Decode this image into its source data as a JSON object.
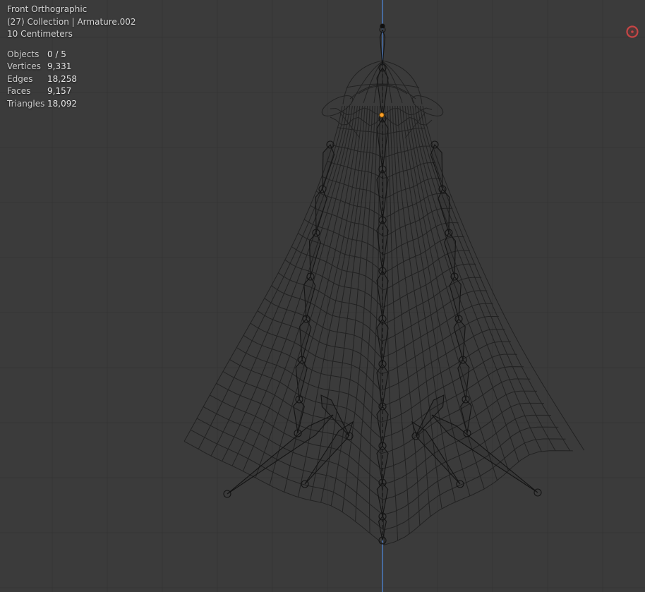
{
  "overlay": {
    "view_name": "Front Orthographic",
    "context": "(27) Collection | Armature.002",
    "scale": "10 Centimeters",
    "stats": [
      {
        "label": "Objects",
        "value": "0 / 5"
      },
      {
        "label": "Vertices",
        "value": "9,331"
      },
      {
        "label": "Edges",
        "value": "18,258"
      },
      {
        "label": "Faces",
        "value": "9,157"
      },
      {
        "label": "Triangles",
        "value": "18,092"
      }
    ]
  },
  "theme": {
    "background": "#3b3b3b",
    "grid_line": "#343434",
    "wire": "#222222",
    "bone_outline": "#141414",
    "axis_z": "#4b77b8",
    "origin_selected": "#ffa12b",
    "object_red": "#c64545",
    "text": "#d6d6d6"
  }
}
